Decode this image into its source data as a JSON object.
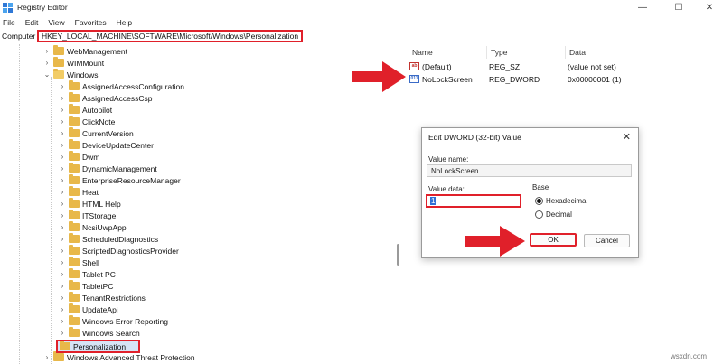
{
  "window": {
    "title": "Registry Editor"
  },
  "menu": [
    "File",
    "Edit",
    "View",
    "Favorites",
    "Help"
  ],
  "address": {
    "label": "Computer",
    "path": "HKEY_LOCAL_MACHINE\\SOFTWARE\\Microsoft\\Windows\\Personalization"
  },
  "tree": {
    "top_items": [
      "WebManagement",
      "WIMMount",
      "Windows"
    ],
    "children": [
      "AssignedAccessConfiguration",
      "AssignedAccessCsp",
      "Autopilot",
      "ClickNote",
      "CurrentVersion",
      "DeviceUpdateCenter",
      "Dwm",
      "DynamicManagement",
      "EnterpriseResourceManager",
      "Heat",
      "HTML Help",
      "ITStorage",
      "NcsiUwpApp",
      "ScheduledDiagnostics",
      "ScriptedDiagnosticsProvider",
      "Shell",
      "Tablet PC",
      "TabletPC",
      "TenantRestrictions",
      "UpdateApi",
      "Windows Error Reporting",
      "Windows Search",
      "Personalization"
    ],
    "last_item": "Windows Advanced Threat Protection",
    "selected": "Personalization"
  },
  "values": {
    "headers": {
      "name": "Name",
      "type": "Type",
      "data": "Data"
    },
    "rows": [
      {
        "icon": "ab",
        "name": "(Default)",
        "type": "REG_SZ",
        "data": "(value not set)"
      },
      {
        "icon": "011",
        "name": "NoLockScreen",
        "type": "REG_DWORD",
        "data": "0x00000001 (1)"
      }
    ]
  },
  "dialog": {
    "title": "Edit DWORD (32-bit) Value",
    "value_name_label": "Value name:",
    "value_name": "NoLockScreen",
    "value_data_label": "Value data:",
    "value_data": "1",
    "base_label": "Base",
    "base_options": [
      "Hexadecimal",
      "Decimal"
    ],
    "base_selected": "Hexadecimal",
    "ok": "OK",
    "cancel": "Cancel"
  },
  "watermark": "wsxdn.com",
  "colors": {
    "highlight": "#e0202a",
    "folder": "#e8b84a",
    "selection": "#d6e4f5"
  }
}
